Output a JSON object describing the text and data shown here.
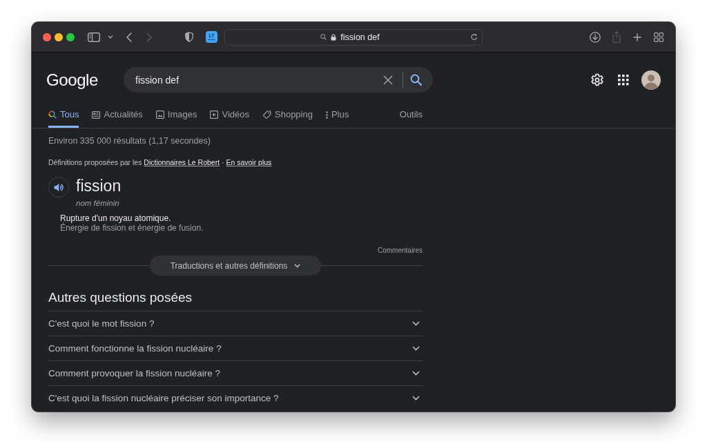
{
  "browser": {
    "extension_label": "LT",
    "address": "fission def",
    "forward_disabled": true,
    "share_disabled": true
  },
  "header": {
    "logo": "Google",
    "search_value": "fission def"
  },
  "tabs": [
    {
      "label": "Tous",
      "kind": "all",
      "selected": true
    },
    {
      "label": "Actualités",
      "kind": "news",
      "selected": false
    },
    {
      "label": "Images",
      "kind": "images",
      "selected": false
    },
    {
      "label": "Vidéos",
      "kind": "videos",
      "selected": false
    },
    {
      "label": "Shopping",
      "kind": "shopping",
      "selected": false
    },
    {
      "label": "Plus",
      "kind": "more",
      "selected": false
    }
  ],
  "tools": "Outils",
  "result_stats": "Environ 335 000 résultats (1,17 secondes)",
  "dictionary": {
    "source_prefix": "Définitions proposées par les",
    "source_link": "Dictionnaires Le Robert",
    "separator": "·",
    "learn_more": "En savoir plus",
    "word": "fission",
    "part_of_speech": "nom féminin",
    "definition": "Rupture d'un noyau atomique.",
    "example": "Énergie de fission et énergie de fusion.",
    "feedback": "Commentaires",
    "more_button": "Traductions et autres définitions"
  },
  "related_questions": {
    "title": "Autres questions posées",
    "items": [
      {
        "question": "C'est quoi le mot fission ?",
        "expanded": false
      },
      {
        "question": "Comment fonctionne la fission nucléaire ?",
        "expanded": false
      },
      {
        "question": "Comment provoquer la fission nucléaire ?",
        "expanded": false
      },
      {
        "question": "C'est quoi la fission nucléaire préciser son importance ?",
        "expanded": false
      }
    ]
  }
}
